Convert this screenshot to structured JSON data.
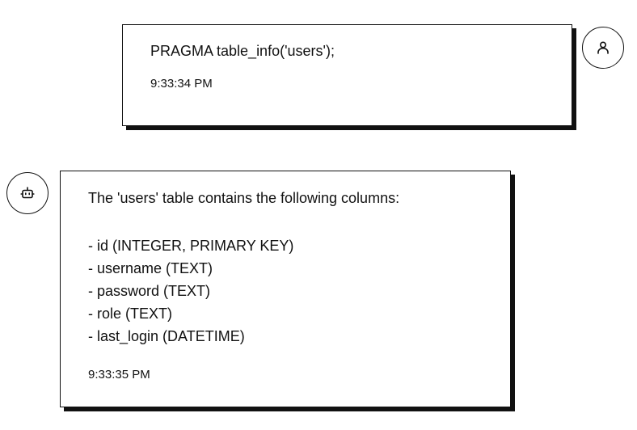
{
  "messages": [
    {
      "role": "user",
      "avatar_icon": "user-icon",
      "text": "PRAGMA table_info('users');",
      "time": "9:33:34 PM"
    },
    {
      "role": "assistant",
      "avatar_icon": "bot-icon",
      "intro": "The 'users' table contains the following columns:",
      "lines": [
        "- id (INTEGER, PRIMARY KEY)",
        "- username (TEXT)",
        "- password (TEXT)",
        "- role (TEXT)",
        "- last_login (DATETIME)"
      ],
      "time": "9:33:35 PM"
    }
  ],
  "colors": {
    "border": "#111111",
    "background": "#ffffff",
    "text": "#111111"
  }
}
